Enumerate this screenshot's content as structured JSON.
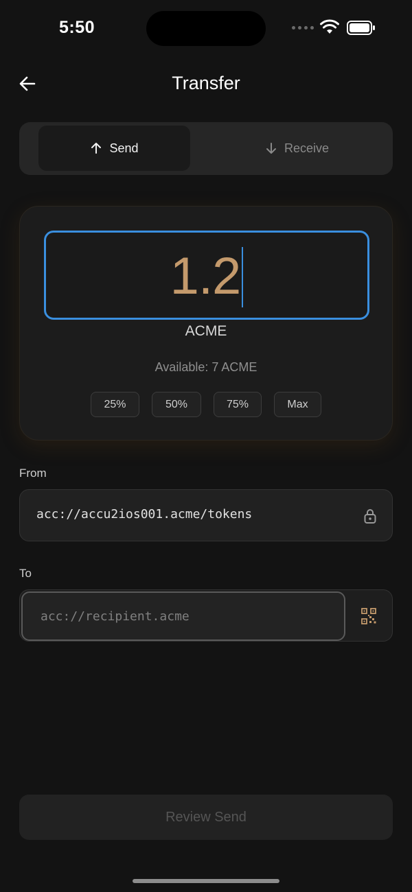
{
  "status_bar": {
    "time": "5:50"
  },
  "header": {
    "title": "Transfer"
  },
  "tabs": {
    "send_label": "Send",
    "receive_label": "Receive",
    "active": "Send"
  },
  "amount": {
    "value": "1.2",
    "unit": "ACME",
    "available": "Available: 7 ACME",
    "quick_buttons": [
      "25%",
      "50%",
      "75%",
      "Max"
    ]
  },
  "from": {
    "label": "From",
    "value": "acc://accu2ios001.acme/tokens"
  },
  "to": {
    "label": "To",
    "placeholder": "acc://recipient.acme",
    "value": ""
  },
  "actions": {
    "review_label": "Review Send"
  },
  "colors": {
    "accent": "#3a8fdf",
    "amount": "#c49a6c",
    "qr": "#c49a6c"
  }
}
